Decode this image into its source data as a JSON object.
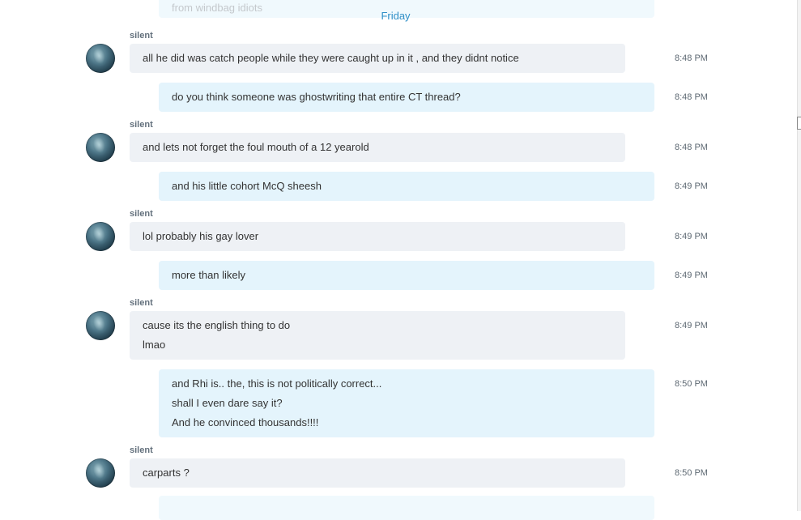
{
  "app": {
    "name": "Skype"
  },
  "conversation": {
    "previous_fragment": "from windbag idiots",
    "day_separator": "Friday",
    "messages": [
      {
        "direction": "in",
        "sender": "silent",
        "lines": [
          "all he did was catch people while they were caught up in it  ,  and they didnt notice"
        ],
        "time": "8:48 PM"
      },
      {
        "direction": "out",
        "lines": [
          "do you think someone was ghostwriting that entire CT thread?"
        ],
        "time": "8:48 PM"
      },
      {
        "direction": "in",
        "sender": "silent",
        "lines": [
          "and lets not forget the foul mouth of a 12 yearold"
        ],
        "time": "8:48 PM"
      },
      {
        "direction": "out",
        "lines": [
          "and his little cohort McQ sheesh"
        ],
        "time": "8:49 PM"
      },
      {
        "direction": "in",
        "sender": "silent",
        "lines": [
          "lol probably his gay lover"
        ],
        "time": "8:49 PM"
      },
      {
        "direction": "out",
        "lines": [
          "more than likely"
        ],
        "time": "8:49 PM"
      },
      {
        "direction": "in",
        "sender": "silent",
        "lines": [
          "cause its the english thing to do",
          "lmao"
        ],
        "time": "8:49 PM"
      },
      {
        "direction": "out",
        "lines": [
          "and Rhi is.. the, this is not politically correct...",
          "shall I even dare say it?",
          "And he convinced thousands!!!!"
        ],
        "time": "8:50 PM"
      },
      {
        "direction": "in",
        "sender": "silent",
        "lines": [
          "carparts ?"
        ],
        "time": "8:50 PM"
      }
    ]
  },
  "colors": {
    "incoming_bubble": "#eef1f5",
    "outgoing_bubble": "#e4f4fc",
    "day_separator": "#2f8fc7",
    "timestamp": "#5f6a74"
  },
  "icons": {
    "avatar": "contact-avatar",
    "scroll": "scrollbar-grip"
  }
}
